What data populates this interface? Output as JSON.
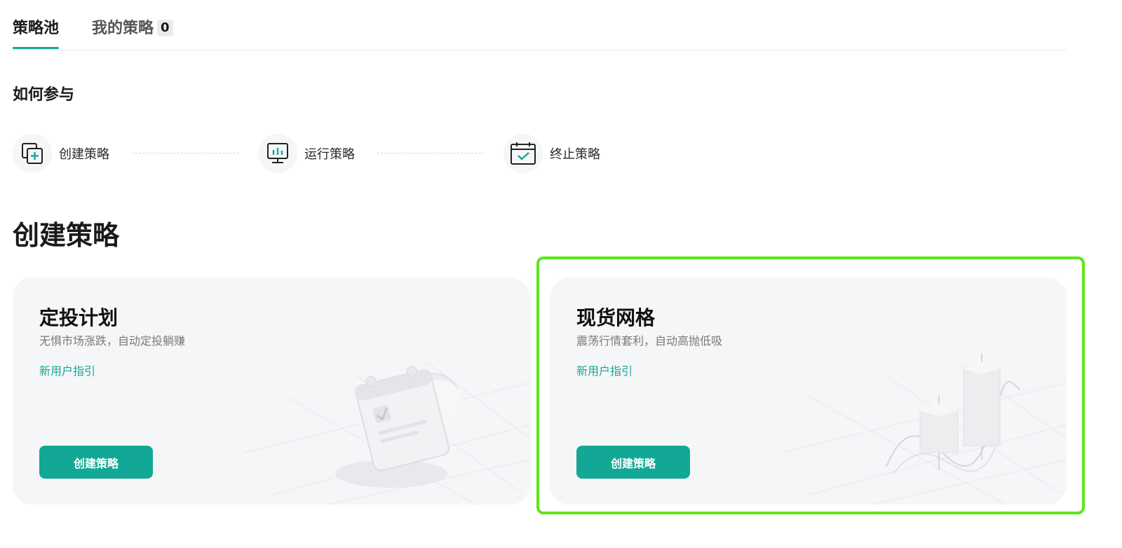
{
  "tabs": {
    "pool_label": "策略池",
    "mine_label": "我的策略",
    "mine_count": "0"
  },
  "how": {
    "title": "如何参与",
    "steps": [
      {
        "label": "创建策略",
        "icon": "add-copy-icon"
      },
      {
        "label": "运行策略",
        "icon": "monitor-chart-icon"
      },
      {
        "label": "终止策略",
        "icon": "calendar-check-icon"
      }
    ]
  },
  "create": {
    "title": "创建策略",
    "cards": [
      {
        "title": "定投计划",
        "desc": "无惧市场涨跌，自动定投躺赚",
        "guide": "新用户指引",
        "button": "创建策略",
        "illustration": "calendar-coin-illustration"
      },
      {
        "title": "现货网格",
        "desc": "震荡行情套利，自动高抛低吸",
        "guide": "新用户指引",
        "button": "创建策略",
        "illustration": "candlestick-illustration"
      }
    ]
  },
  "colors": {
    "accent": "#13a896",
    "highlight": "#5ee61a",
    "card_bg": "#f5f6f8"
  }
}
